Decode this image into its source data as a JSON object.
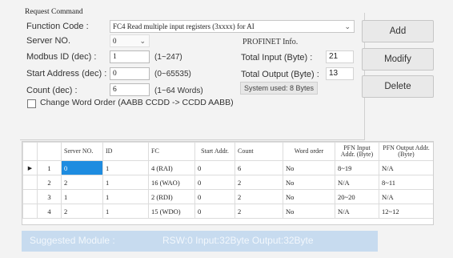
{
  "request_command": {
    "title": "Request Command",
    "function_code_label": "Function Code :",
    "function_code_value": "FC4  Read multiple input registers (3xxxx)  for AI",
    "server_no_label": "Server NO.",
    "server_no_value": "0",
    "modbus_id_label": "Modbus ID (dec) :",
    "modbus_id_value": "1",
    "modbus_id_hint": "(1~247)",
    "start_address_label": "Start Address (dec) :",
    "start_address_value": "0",
    "start_address_hint": "(0~65535)",
    "count_label": "Count (dec) :",
    "count_value": "6",
    "count_hint": "(1~64 Words)",
    "change_word_order_label": "Change Word Order (AABB CCDD -> CCDD AABB)"
  },
  "profinet_info": {
    "title": "PROFINET Info.",
    "total_input_label": "Total Input (Byte) :",
    "total_input_value": "21",
    "total_output_label": "Total Output (Byte) :",
    "total_output_value": "13",
    "system_used": "System used: 8 Bytes"
  },
  "buttons": {
    "add": "Add",
    "modify": "Modify",
    "delete": "Delete"
  },
  "table": {
    "columns": {
      "server_no": "Server NO.",
      "id": "ID",
      "fc": "FC",
      "start_addr": "Start Addr.",
      "count": "Count",
      "word_order": "Word order",
      "pfn_input": "PFN Input Addr. (Byte)",
      "pfn_output": "PFN Output Addr. (Byte)"
    },
    "rows": [
      {
        "index": "1",
        "server_no": "0",
        "id": "1",
        "fc": "4 (RAI)",
        "start_addr": "0",
        "count": "6",
        "word_order": "No",
        "pfn_input": "8~19",
        "pfn_output": "N/A",
        "current": "▶"
      },
      {
        "index": "2",
        "server_no": "2",
        "id": "1",
        "fc": "16 (WAO)",
        "start_addr": "0",
        "count": "2",
        "word_order": "No",
        "pfn_input": "N/A",
        "pfn_output": "8~11"
      },
      {
        "index": "3",
        "server_no": "1",
        "id": "1",
        "fc": "2 (RDI)",
        "start_addr": "0",
        "count": "2",
        "word_order": "No",
        "pfn_input": "20~20",
        "pfn_output": "N/A"
      },
      {
        "index": "4",
        "server_no": "2",
        "id": "1",
        "fc": "15 (WDO)",
        "start_addr": "0",
        "count": "2",
        "word_order": "No",
        "pfn_input": "N/A",
        "pfn_output": "12~12"
      }
    ]
  },
  "footer": {
    "label": "Suggested Module :",
    "value": "RSW:0 Input:32Byte Output:32Byte"
  },
  "colors": {
    "selection": "#1e8ce0",
    "footer_bg": "#c7dbef"
  },
  "icons": {
    "dropdown": "chevron-down-icon",
    "row_pointer": "row-pointer-icon"
  }
}
